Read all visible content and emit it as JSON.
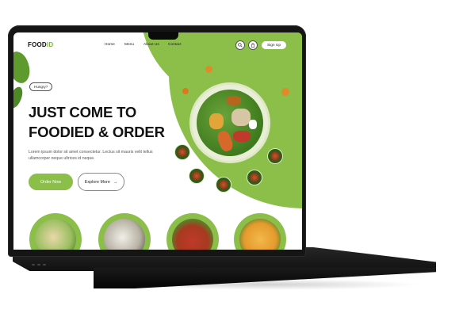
{
  "site": {
    "logo_main": "FOOD",
    "logo_accent": "ID",
    "nav": [
      "Home",
      "Menu",
      "About Us",
      "Contact"
    ],
    "signup_label": "Sign Up",
    "badge": "Hungry?",
    "headline_line1": "JUST COME TO",
    "headline_line2": "FOODIED & ORDER",
    "paragraph": "Lorem ipsum dolor sit amet consectetur. Lectus sit mauris velit tellus ullamcorper neque ultrices id neque.",
    "order_button": "Order Now",
    "explore_button": "Explore More",
    "explore_arrow": "→"
  },
  "colors": {
    "accent_green": "#8cbf4a",
    "dark_text": "#111111",
    "laptop_body": "#151515"
  },
  "icons": {
    "search": "search-icon",
    "cart": "cart-icon",
    "arrow": "arrow-right-icon"
  }
}
